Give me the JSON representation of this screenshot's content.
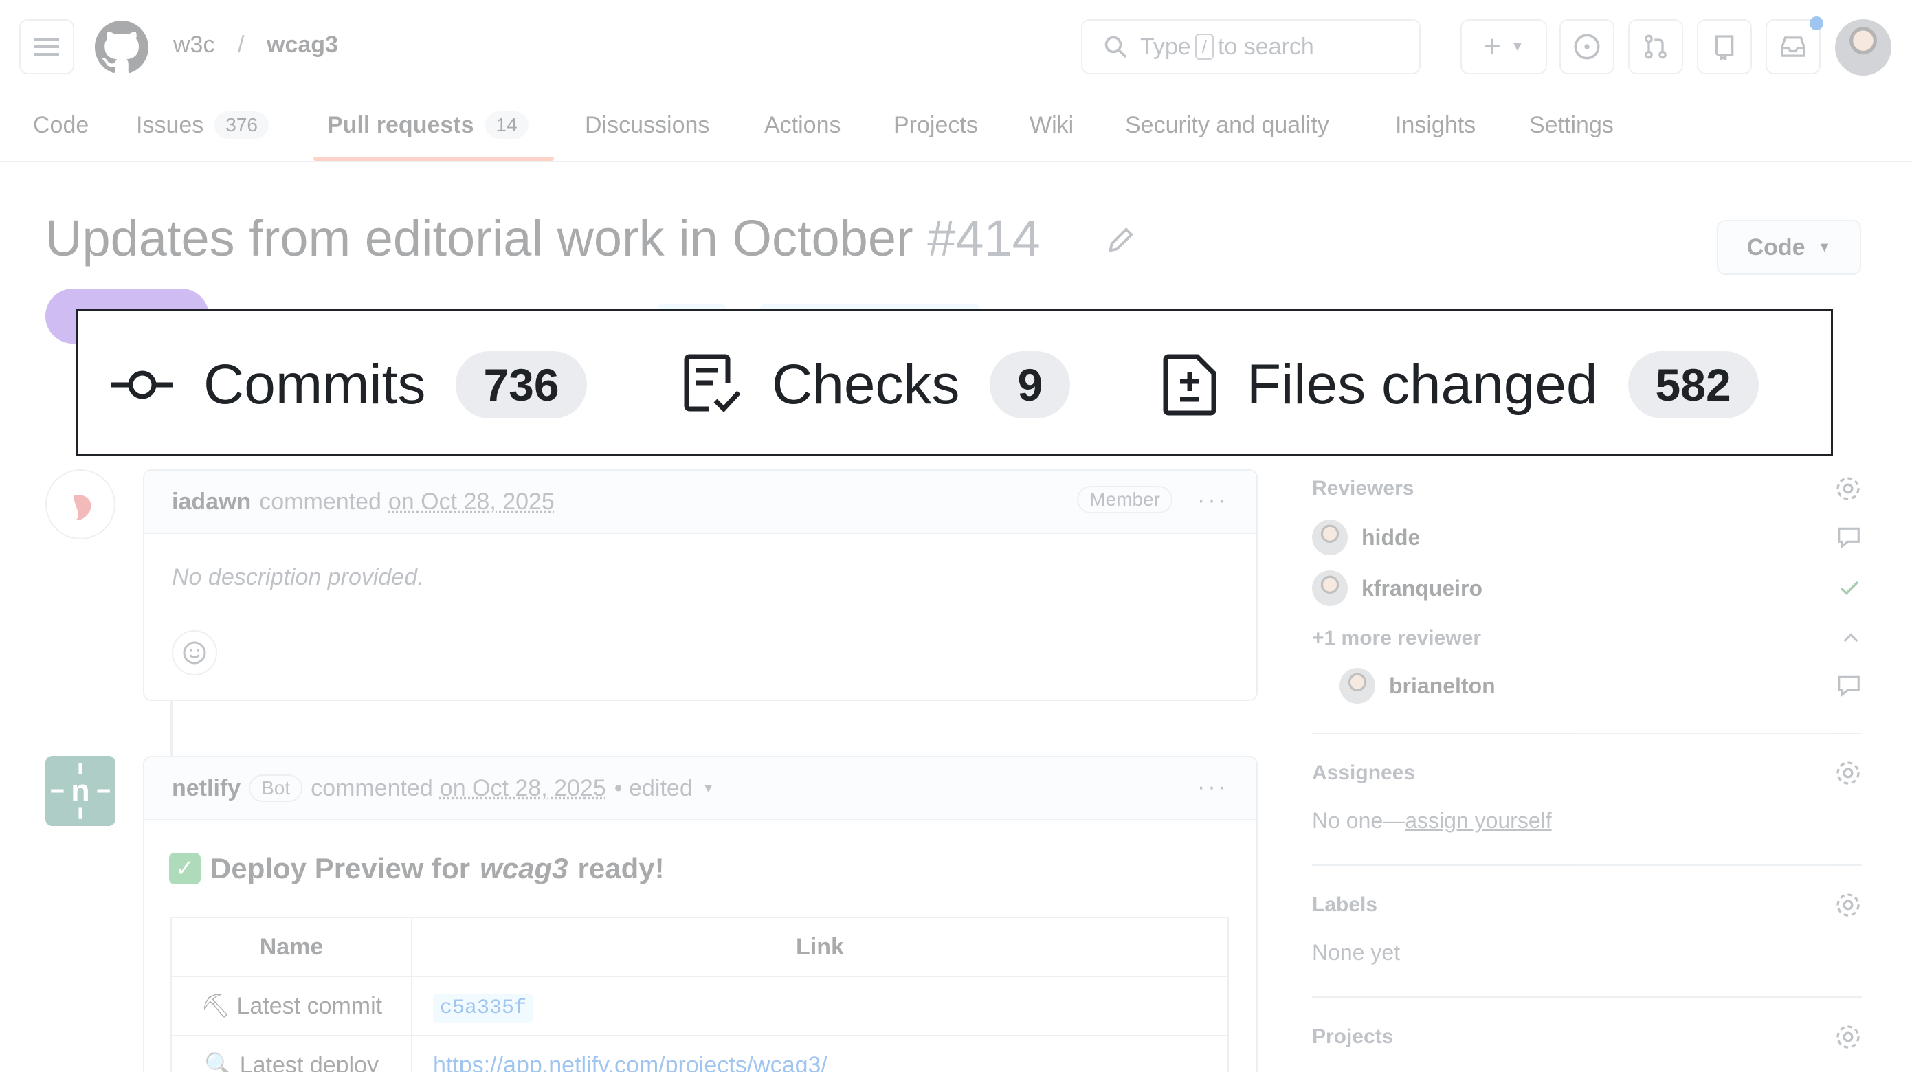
{
  "header": {
    "owner": "w3c",
    "separator": "/",
    "repo": "wcag3",
    "search_prefix": "Type",
    "search_key": "/",
    "search_suffix": "to search"
  },
  "repo_tabs": [
    {
      "label": "Code",
      "count": ""
    },
    {
      "label": "Issues",
      "count": "376"
    },
    {
      "label": "Pull requests",
      "count": "14"
    },
    {
      "label": "Discussions",
      "count": ""
    },
    {
      "label": "Actions",
      "count": ""
    },
    {
      "label": "Projects",
      "count": ""
    },
    {
      "label": "Wiki",
      "count": ""
    },
    {
      "label": "Security and quality",
      "count": ""
    },
    {
      "label": "Insights",
      "count": ""
    },
    {
      "label": "Settings",
      "count": ""
    }
  ],
  "pr": {
    "title": "Updates from editorial work in October",
    "number": "#414",
    "code_button": "Code"
  },
  "pr_tabs_zoomed": {
    "commits_label": "Commits",
    "commits_count": "736",
    "checks_label": "Checks",
    "checks_count": "9",
    "files_label": "Files changed",
    "files_count": "582"
  },
  "comments": [
    {
      "author": "iadawn",
      "action": "commented",
      "date": "on Oct 28, 2025",
      "badge": "Member",
      "body": "No description provided."
    },
    {
      "author": "netlify",
      "bot_badge": "Bot",
      "action": "commented",
      "date": "on Oct 28, 2025",
      "edited": "• edited",
      "deploy_title_pre": "Deploy Preview for",
      "deploy_title_repo": "wcag3",
      "deploy_title_post": "ready!",
      "table_headers": [
        "Name",
        "Link"
      ],
      "rows": [
        {
          "name": "Latest commit",
          "value": "c5a335f"
        },
        {
          "name": "Latest deploy",
          "value": "https://app.netlify.com/projects/wcag3/"
        }
      ]
    }
  ],
  "sidebar": {
    "reviewers_heading": "Reviewers",
    "reviewers": [
      "hidde",
      "kfranqueiro"
    ],
    "more_reviewers": "+1 more reviewer",
    "extra_reviewer": "brianelton",
    "assignees_heading": "Assignees",
    "assignees_none": "No one—",
    "assign_yourself": "assign yourself",
    "labels_heading": "Labels",
    "labels_none": "None yet",
    "projects_heading": "Projects"
  },
  "colors": {
    "accent_underline": "#fd8c73",
    "merged_purple": "#8250df",
    "link_blue": "#0969da"
  }
}
